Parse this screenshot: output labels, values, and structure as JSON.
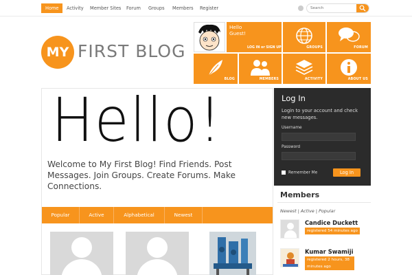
{
  "nav": {
    "items": [
      "Home",
      "Activity",
      "Member Sites",
      "Forum",
      "Groups",
      "Members",
      "Register"
    ]
  },
  "search": {
    "placeholder": "Search"
  },
  "logo": {
    "circle_text": "MY",
    "text": "FIRST BLOG"
  },
  "tiles": {
    "hello_line1": "Hello",
    "hello_line2": "Guest!",
    "login_signup": "LOG IN or SIGN UP",
    "groups": "GROUPS",
    "forum": "FORUM",
    "blog": "BLOG",
    "members": "MEMBERS",
    "activity": "ACTIVITY",
    "about": "ABOUT US"
  },
  "main": {
    "big_hello": "Hello!",
    "welcome": "Welcome to My First Blog! Find Friends. Post Messages. Join Groups. Create Forums. Make Connections.",
    "tabs": [
      "Popular",
      "Active",
      "Alphabetical",
      "Newest"
    ]
  },
  "login": {
    "title": "Log In",
    "desc": "Login to your account and check new messages.",
    "username_label": "Username",
    "password_label": "Password",
    "remember_label": "Remember Me",
    "button": "Log In"
  },
  "members": {
    "title": "Members",
    "filters": "Newest | Active | Popular",
    "list": [
      {
        "name": "Candice Duckett",
        "time": "registered 54 minutes ago"
      },
      {
        "name": "Kumar Swamiji",
        "time": "registered 2 hours, 38 minutes ago"
      }
    ]
  },
  "colors": {
    "accent": "#f7941d",
    "dark_panel": "#2b2b2b"
  }
}
